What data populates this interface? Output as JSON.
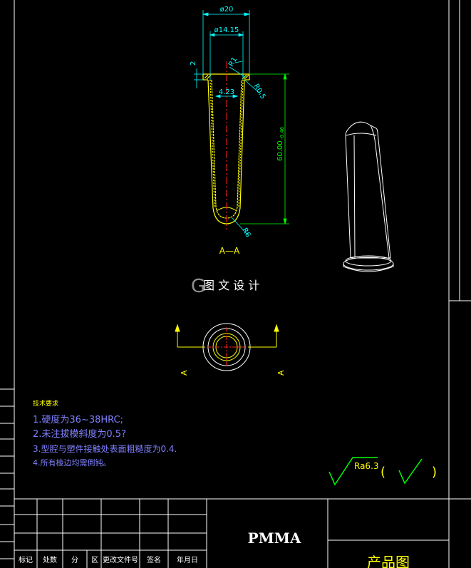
{
  "section_view": {
    "label": "A—A",
    "dims": {
      "outer_diameter": "ø20",
      "inner_diameter": "ø14.15",
      "flange_height": "2",
      "fillet_top": "R1",
      "fillet_inner": "R0.5",
      "wall_offset": "4.23",
      "length": "60.00",
      "length_tol": "-0.46",
      "tip_radius": "R6"
    }
  },
  "top_view": {
    "arrow_label_left": "A",
    "arrow_label_right": "A"
  },
  "watermark": {
    "text": "图 文 设 计"
  },
  "tech_requirements": {
    "heading": "技术要求",
    "items": [
      "1.硬度为36~38HRC;",
      "2.未注拔模斜度为0.5?",
      "3.型腔与塑件接触处表面粗糙度为0.4.",
      "4.所有棱边均需倒钝。"
    ]
  },
  "roughness": {
    "label": "Ra6.3",
    "paren_open": "(",
    "paren_close": ")"
  },
  "title_block": {
    "material": "PMMA",
    "drawing_name": "产品图",
    "header_cells": [
      "标记",
      "处数",
      "分",
      "区",
      "更改文件号",
      "签名",
      "年月日"
    ]
  },
  "colors": {
    "background": "#000000",
    "frame": "#ffffff",
    "dimension": "#00ffff",
    "outline": "#ffff00",
    "centerline": "#ff2020",
    "length_dim": "#00ff00",
    "text_yellow": "#ffff00",
    "text_blue": "#8080ff",
    "roughness": "#00ff00"
  }
}
